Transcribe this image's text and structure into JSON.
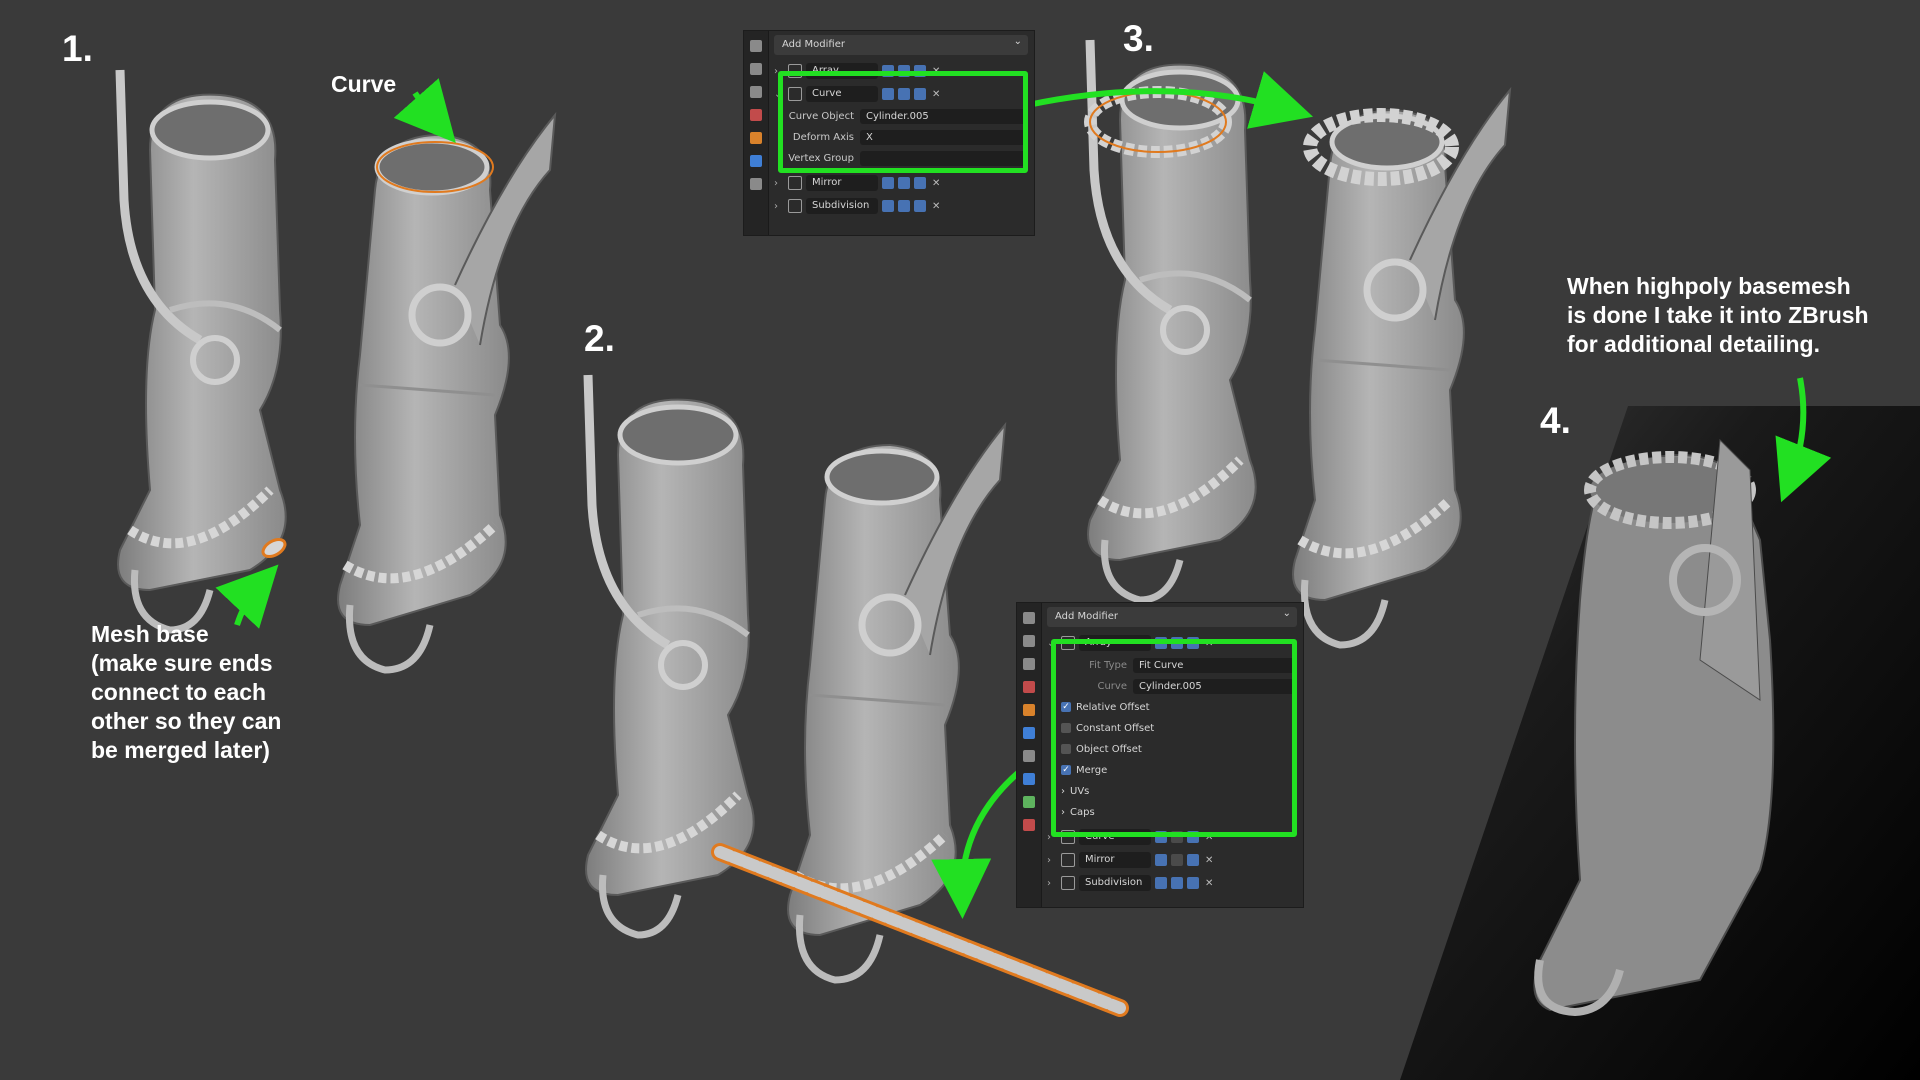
{
  "steps": {
    "s1": "1.",
    "s2": "2.",
    "s3": "3.",
    "s4": "4."
  },
  "labels": {
    "curve": "Curve",
    "mesh_base": [
      "Mesh base",
      "(make sure ends",
      "connect to each",
      "other so they can",
      "be merged later)"
    ],
    "zbrush_note": [
      "When highpoly basemesh",
      "is done I take it into ZBrush",
      "for additional detailing."
    ]
  },
  "panel_top": {
    "add_modifier": "Add Modifier",
    "modifiers": [
      {
        "name": "Array",
        "expanded": false
      },
      {
        "name": "Curve",
        "expanded": true
      },
      {
        "name": "Mirror",
        "expanded": false
      },
      {
        "name": "Subdivision",
        "expanded": false
      }
    ],
    "curve_props": {
      "curve_object_label": "Curve Object",
      "curve_object_value": "Cylinder.005",
      "deform_axis_label": "Deform Axis",
      "deform_axis_value": "X",
      "vertex_group_label": "Vertex Group",
      "vertex_group_value": ""
    }
  },
  "panel_bottom": {
    "add_modifier": "Add Modifier",
    "array_name": "Array",
    "fit_type_label": "Fit Type",
    "fit_type_value": "Fit Curve",
    "curve_label": "Curve",
    "curve_value": "Cylinder.005",
    "options": [
      {
        "label": "Relative Offset",
        "checked": true
      },
      {
        "label": "Constant Offset",
        "checked": false
      },
      {
        "label": "Object Offset",
        "checked": false
      },
      {
        "label": "Merge",
        "checked": true
      },
      {
        "label": "UVs",
        "checked": null
      },
      {
        "label": "Caps",
        "checked": null
      }
    ],
    "collapsed": [
      "Curve",
      "Mirror",
      "Subdivision"
    ]
  },
  "colors": {
    "highlight": "#22e022",
    "selection": "#e07a1f",
    "background": "#3a3a3a",
    "mesh": "#a9a9a9"
  }
}
